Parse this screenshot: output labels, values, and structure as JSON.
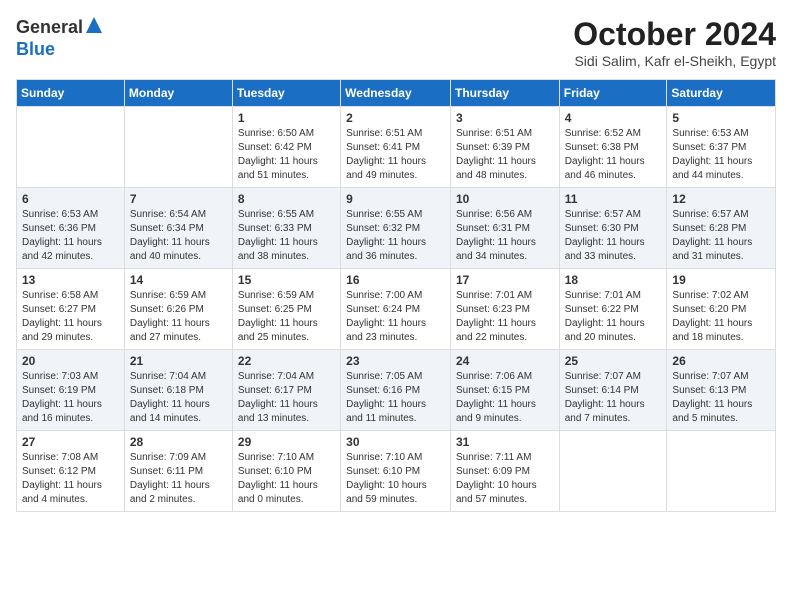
{
  "logo": {
    "general": "General",
    "blue": "Blue"
  },
  "title": "October 2024",
  "location": "Sidi Salim, Kafr el-Sheikh, Egypt",
  "days_of_week": [
    "Sunday",
    "Monday",
    "Tuesday",
    "Wednesday",
    "Thursday",
    "Friday",
    "Saturday"
  ],
  "weeks": [
    [
      {
        "day": "",
        "sunrise": "",
        "sunset": "",
        "daylight": ""
      },
      {
        "day": "",
        "sunrise": "",
        "sunset": "",
        "daylight": ""
      },
      {
        "day": "1",
        "sunrise": "Sunrise: 6:50 AM",
        "sunset": "Sunset: 6:42 PM",
        "daylight": "Daylight: 11 hours and 51 minutes."
      },
      {
        "day": "2",
        "sunrise": "Sunrise: 6:51 AM",
        "sunset": "Sunset: 6:41 PM",
        "daylight": "Daylight: 11 hours and 49 minutes."
      },
      {
        "day": "3",
        "sunrise": "Sunrise: 6:51 AM",
        "sunset": "Sunset: 6:39 PM",
        "daylight": "Daylight: 11 hours and 48 minutes."
      },
      {
        "day": "4",
        "sunrise": "Sunrise: 6:52 AM",
        "sunset": "Sunset: 6:38 PM",
        "daylight": "Daylight: 11 hours and 46 minutes."
      },
      {
        "day": "5",
        "sunrise": "Sunrise: 6:53 AM",
        "sunset": "Sunset: 6:37 PM",
        "daylight": "Daylight: 11 hours and 44 minutes."
      }
    ],
    [
      {
        "day": "6",
        "sunrise": "Sunrise: 6:53 AM",
        "sunset": "Sunset: 6:36 PM",
        "daylight": "Daylight: 11 hours and 42 minutes."
      },
      {
        "day": "7",
        "sunrise": "Sunrise: 6:54 AM",
        "sunset": "Sunset: 6:34 PM",
        "daylight": "Daylight: 11 hours and 40 minutes."
      },
      {
        "day": "8",
        "sunrise": "Sunrise: 6:55 AM",
        "sunset": "Sunset: 6:33 PM",
        "daylight": "Daylight: 11 hours and 38 minutes."
      },
      {
        "day": "9",
        "sunrise": "Sunrise: 6:55 AM",
        "sunset": "Sunset: 6:32 PM",
        "daylight": "Daylight: 11 hours and 36 minutes."
      },
      {
        "day": "10",
        "sunrise": "Sunrise: 6:56 AM",
        "sunset": "Sunset: 6:31 PM",
        "daylight": "Daylight: 11 hours and 34 minutes."
      },
      {
        "day": "11",
        "sunrise": "Sunrise: 6:57 AM",
        "sunset": "Sunset: 6:30 PM",
        "daylight": "Daylight: 11 hours and 33 minutes."
      },
      {
        "day": "12",
        "sunrise": "Sunrise: 6:57 AM",
        "sunset": "Sunset: 6:28 PM",
        "daylight": "Daylight: 11 hours and 31 minutes."
      }
    ],
    [
      {
        "day": "13",
        "sunrise": "Sunrise: 6:58 AM",
        "sunset": "Sunset: 6:27 PM",
        "daylight": "Daylight: 11 hours and 29 minutes."
      },
      {
        "day": "14",
        "sunrise": "Sunrise: 6:59 AM",
        "sunset": "Sunset: 6:26 PM",
        "daylight": "Daylight: 11 hours and 27 minutes."
      },
      {
        "day": "15",
        "sunrise": "Sunrise: 6:59 AM",
        "sunset": "Sunset: 6:25 PM",
        "daylight": "Daylight: 11 hours and 25 minutes."
      },
      {
        "day": "16",
        "sunrise": "Sunrise: 7:00 AM",
        "sunset": "Sunset: 6:24 PM",
        "daylight": "Daylight: 11 hours and 23 minutes."
      },
      {
        "day": "17",
        "sunrise": "Sunrise: 7:01 AM",
        "sunset": "Sunset: 6:23 PM",
        "daylight": "Daylight: 11 hours and 22 minutes."
      },
      {
        "day": "18",
        "sunrise": "Sunrise: 7:01 AM",
        "sunset": "Sunset: 6:22 PM",
        "daylight": "Daylight: 11 hours and 20 minutes."
      },
      {
        "day": "19",
        "sunrise": "Sunrise: 7:02 AM",
        "sunset": "Sunset: 6:20 PM",
        "daylight": "Daylight: 11 hours and 18 minutes."
      }
    ],
    [
      {
        "day": "20",
        "sunrise": "Sunrise: 7:03 AM",
        "sunset": "Sunset: 6:19 PM",
        "daylight": "Daylight: 11 hours and 16 minutes."
      },
      {
        "day": "21",
        "sunrise": "Sunrise: 7:04 AM",
        "sunset": "Sunset: 6:18 PM",
        "daylight": "Daylight: 11 hours and 14 minutes."
      },
      {
        "day": "22",
        "sunrise": "Sunrise: 7:04 AM",
        "sunset": "Sunset: 6:17 PM",
        "daylight": "Daylight: 11 hours and 13 minutes."
      },
      {
        "day": "23",
        "sunrise": "Sunrise: 7:05 AM",
        "sunset": "Sunset: 6:16 PM",
        "daylight": "Daylight: 11 hours and 11 minutes."
      },
      {
        "day": "24",
        "sunrise": "Sunrise: 7:06 AM",
        "sunset": "Sunset: 6:15 PM",
        "daylight": "Daylight: 11 hours and 9 minutes."
      },
      {
        "day": "25",
        "sunrise": "Sunrise: 7:07 AM",
        "sunset": "Sunset: 6:14 PM",
        "daylight": "Daylight: 11 hours and 7 minutes."
      },
      {
        "day": "26",
        "sunrise": "Sunrise: 7:07 AM",
        "sunset": "Sunset: 6:13 PM",
        "daylight": "Daylight: 11 hours and 5 minutes."
      }
    ],
    [
      {
        "day": "27",
        "sunrise": "Sunrise: 7:08 AM",
        "sunset": "Sunset: 6:12 PM",
        "daylight": "Daylight: 11 hours and 4 minutes."
      },
      {
        "day": "28",
        "sunrise": "Sunrise: 7:09 AM",
        "sunset": "Sunset: 6:11 PM",
        "daylight": "Daylight: 11 hours and 2 minutes."
      },
      {
        "day": "29",
        "sunrise": "Sunrise: 7:10 AM",
        "sunset": "Sunset: 6:10 PM",
        "daylight": "Daylight: 11 hours and 0 minutes."
      },
      {
        "day": "30",
        "sunrise": "Sunrise: 7:10 AM",
        "sunset": "Sunset: 6:10 PM",
        "daylight": "Daylight: 10 hours and 59 minutes."
      },
      {
        "day": "31",
        "sunrise": "Sunrise: 7:11 AM",
        "sunset": "Sunset: 6:09 PM",
        "daylight": "Daylight: 10 hours and 57 minutes."
      },
      {
        "day": "",
        "sunrise": "",
        "sunset": "",
        "daylight": ""
      },
      {
        "day": "",
        "sunrise": "",
        "sunset": "",
        "daylight": ""
      }
    ]
  ]
}
